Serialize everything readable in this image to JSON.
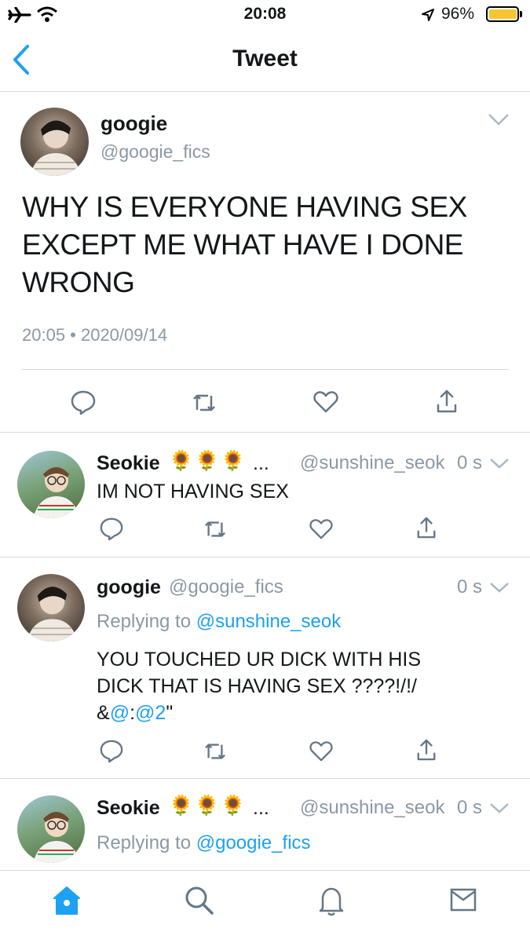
{
  "status_bar": {
    "time": "20:08",
    "battery": "96%"
  },
  "header": {
    "title": "Tweet"
  },
  "main_tweet": {
    "display_name": "googie",
    "handle": "@googie_fics",
    "text_lines": [
      "WHY IS EVERYONE HAVING SEX",
      "EXCEPT ME WHAT HAVE I DONE",
      "WRONG"
    ],
    "timestamp": "20:05 • 2020/09/14"
  },
  "replies": [
    {
      "display_name": "Seokie",
      "name_suffix": "...",
      "handle": "@sunshine_seok",
      "time": "0 s",
      "text": "IM NOT HAVING SEX"
    },
    {
      "display_name": "googie",
      "handle": "@googie_fics",
      "time": "0 s",
      "replying_prefix": "Replying to ",
      "replying_handle": "@sunshine_seok",
      "text_line1": "YOU TOUCHED UR DICK WITH HIS",
      "text_line2": "DICK THAT IS HAVING SEX ????!/!/",
      "text_line3_a": "&",
      "text_line3_mention1": "@",
      "text_line3_b": ":",
      "text_line3_mention2": "@2",
      "text_line3_c": "\""
    },
    {
      "display_name": "Seokie",
      "name_suffix": "...",
      "handle": "@sunshine_seok",
      "time": "0 s",
      "replying_prefix": "Replying to ",
      "replying_handle": "@googie_fics"
    }
  ],
  "tab_bar": {
    "icons": [
      "home-icon",
      "search-icon",
      "notifications-icon",
      "messages-icon"
    ]
  },
  "colors": {
    "accent": "#1da1f2",
    "battery": "#f7c531",
    "text": "#14171a",
    "muted": "#8b98a5"
  }
}
